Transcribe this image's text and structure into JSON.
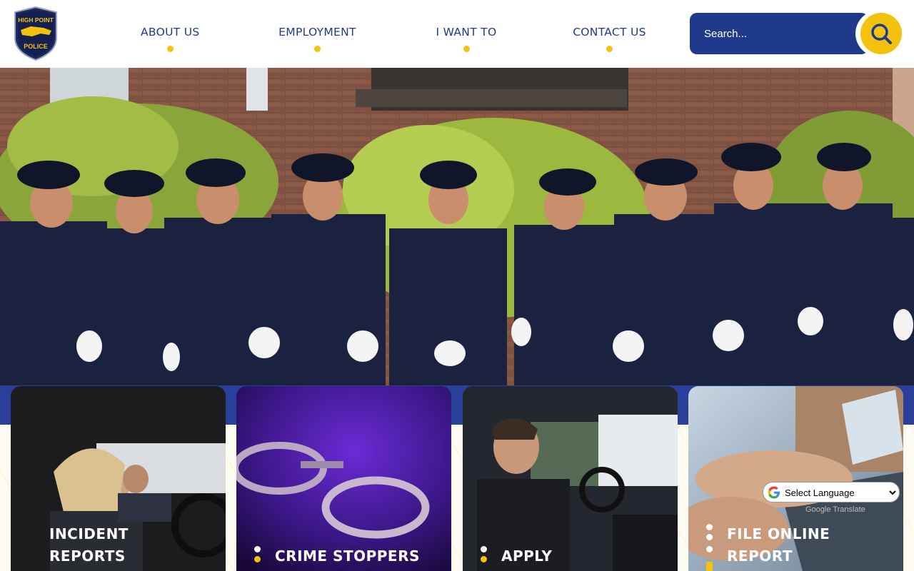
{
  "logo": {
    "line1": "HIGH POINT",
    "line2": "POLICE"
  },
  "nav": [
    {
      "label": "ABOUT US"
    },
    {
      "label": "EMPLOYMENT"
    },
    {
      "label": "I WANT TO"
    },
    {
      "label": "CONTACT US"
    }
  ],
  "search": {
    "placeholder": "Search..."
  },
  "cards": [
    {
      "line1": "INCIDENT",
      "line2": "REPORTS"
    },
    {
      "line1": "",
      "line2": "CRIME STOPPERS"
    },
    {
      "line1": "",
      "line2": "APPLY"
    },
    {
      "line1": "FILE ONLINE",
      "line2": "REPORT"
    }
  ],
  "language": {
    "selected": "Select Language",
    "powered_by": "Google Translate"
  },
  "colors": {
    "brand_blue": "#1f3a8a",
    "accent_yellow": "#f4c20d"
  }
}
